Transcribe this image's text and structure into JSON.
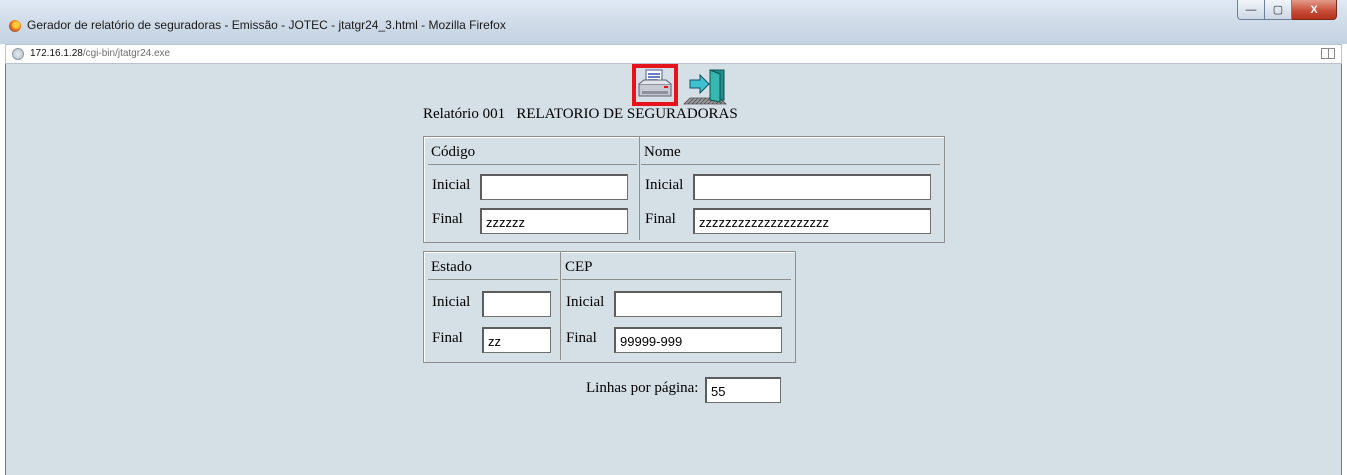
{
  "window": {
    "title": "Gerador de relatório de seguradoras - Emissão - JOTEC - jtatgr24_3.html - Mozilla Firefox",
    "minimize_label": "—",
    "maximize_label": "▢",
    "close_label": "X"
  },
  "urlbar": {
    "host": "172.16.1.28",
    "path": "/cgi-bin/jtatgr24.exe"
  },
  "toolbar": {
    "print_icon": "printer-icon",
    "exit_icon": "exit-door-icon",
    "highlight_color": "#e4141a"
  },
  "report": {
    "title": "Relatório 001   RELATORIO DE SEGURADORAS"
  },
  "codigo": {
    "header": "Código",
    "inicial_label": "Inicial",
    "inicial_value": "",
    "final_label": "Final",
    "final_value": "zzzzzz"
  },
  "nome": {
    "header": "Nome",
    "inicial_label": "Inicial",
    "inicial_value": "",
    "final_label": "Final",
    "final_value": "zzzzzzzzzzzzzzzzzzzz"
  },
  "estado": {
    "header": "Estado",
    "inicial_label": "Inicial",
    "inicial_value": "",
    "final_label": "Final",
    "final_value": "zz"
  },
  "cep": {
    "header": "CEP",
    "inicial_label": "Inicial",
    "inicial_value": "",
    "final_label": "Final",
    "final_value": "99999-999"
  },
  "linhas": {
    "label": "Linhas por página:",
    "value": "55"
  },
  "colors": {
    "page_background": "#d5dfe6"
  }
}
